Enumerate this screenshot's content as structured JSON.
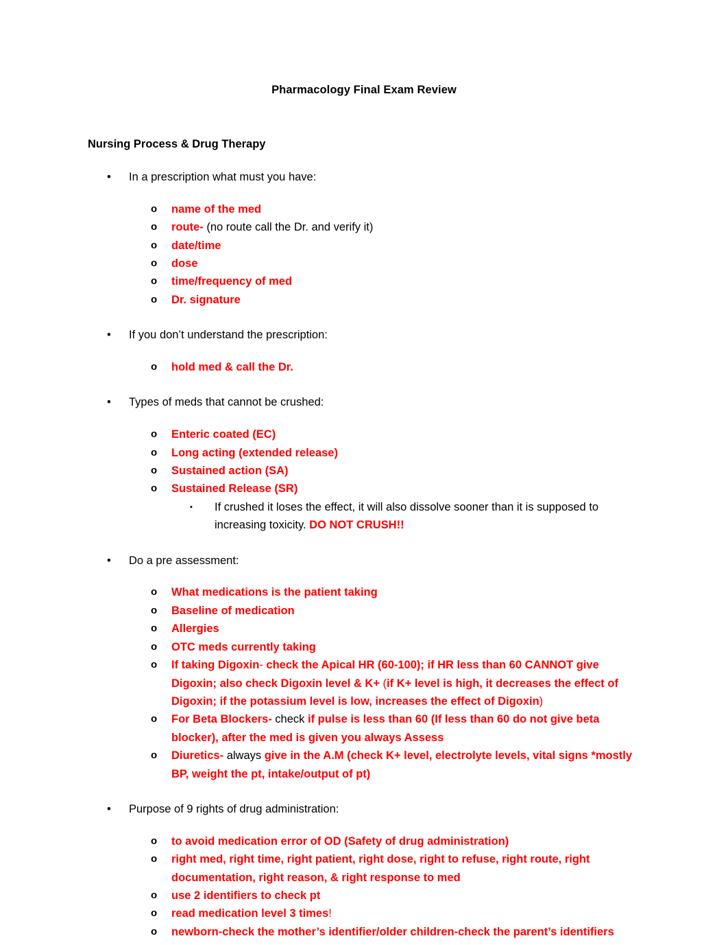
{
  "document": {
    "title": "Pharmacology Final Exam Review",
    "heading": "Nursing Process & Drug Therapy",
    "accent_color": "#ff0000",
    "text_color": "#000000",
    "markers": {
      "level1": "•",
      "level2": "o",
      "level3": "▪"
    }
  },
  "sections": [
    {
      "prompt": "In a prescription what must you have:",
      "items": [
        {
          "red": "name of the med",
          "black": ""
        },
        {
          "red": "route-",
          "black": " (no route call the Dr. and verify it)"
        },
        {
          "red": "date/time",
          "black": ""
        },
        {
          "red": "dose",
          "black": ""
        },
        {
          "red": "time/frequency of med",
          "black": ""
        },
        {
          "red": "Dr. signature",
          "black": ""
        }
      ]
    },
    {
      "prompt": "If you don’t understand the prescription:",
      "items": [
        {
          "red": "hold med & call the Dr.",
          "black": ""
        }
      ]
    },
    {
      "prompt": "Types of meds that cannot be crushed:",
      "items": [
        {
          "red": "Enteric coated (EC)",
          "black": ""
        },
        {
          "red": "Long acting (extended release)",
          "black": ""
        },
        {
          "red": "Sustained action (SA)",
          "black": ""
        },
        {
          "red": "Sustained Release (SR)",
          "black": ""
        }
      ],
      "subnote": {
        "lead": "If crushed it loses the effect, it will also dissolve sooner than it is supposed to increasing toxicity. ",
        "emphasis": "DO NOT CRUSH!!"
      }
    },
    {
      "prompt": "Do a pre assessment:",
      "items": [
        {
          "red": "What medications is the patient taking",
          "black": ""
        },
        {
          "red": "Baseline of medication",
          "black": ""
        },
        {
          "red": "Allergies",
          "black": ""
        },
        {
          "red": "OTC meds currently taking",
          "black": ""
        }
      ],
      "complex_items": [
        {
          "runs": [
            {
              "text": "If taking Digoxin",
              "style": "red-bold"
            },
            {
              "text": "-",
              "style": "red-normal"
            },
            {
              "text": " check the Apical HR (60-100); if HR less than 60 CANNOT give Digoxin; also check Digoxin level & K+ ",
              "style": "red-bold"
            },
            {
              "text": "(",
              "style": "red-normal"
            },
            {
              "text": "if K+ level is high, it decreases the effect of Digoxin; if the potassium level is low, increases the effect of Digoxin",
              "style": "red-bold"
            },
            {
              "text": ")",
              "style": "red-normal"
            }
          ]
        },
        {
          "runs": [
            {
              "text": "For Beta Blockers-",
              "style": "red-bold"
            },
            {
              "text": " check ",
              "style": "black"
            },
            {
              "text": "if pulse is less than 60 (If less than 60 do not give beta blocker), after the med is given you always Assess",
              "style": "red-bold"
            }
          ]
        },
        {
          "runs": [
            {
              "text": "Diuretics-",
              "style": "red-bold"
            },
            {
              "text": " always ",
              "style": "black"
            },
            {
              "text": "give in the A.M (check K+ level, electrolyte levels, vital signs *mostly BP, weight the pt, intake/output of pt)",
              "style": "red-bold"
            }
          ]
        }
      ]
    },
    {
      "prompt": "Purpose of 9 rights of drug administration:",
      "items": [
        {
          "red": "to avoid medication error of OD (Safety of drug administration)",
          "black": ""
        },
        {
          "red": "right med, right time, right patient, right dose, right to refuse, right route, right documentation, right reason, & right response to med",
          "black": ""
        },
        {
          "red": "use 2 identifiers to check pt",
          "black": ""
        }
      ],
      "tail_items": [
        {
          "runs": [
            {
              "text": "read medication level 3 times",
              "style": "red-bold"
            },
            {
              "text": "!",
              "style": "red-normal"
            }
          ]
        },
        {
          "runs": [
            {
              "text": "newborn-check the mother’s identifier/older children-check the parent’s identifiers",
              "style": "red-bold"
            }
          ]
        }
      ]
    }
  ]
}
